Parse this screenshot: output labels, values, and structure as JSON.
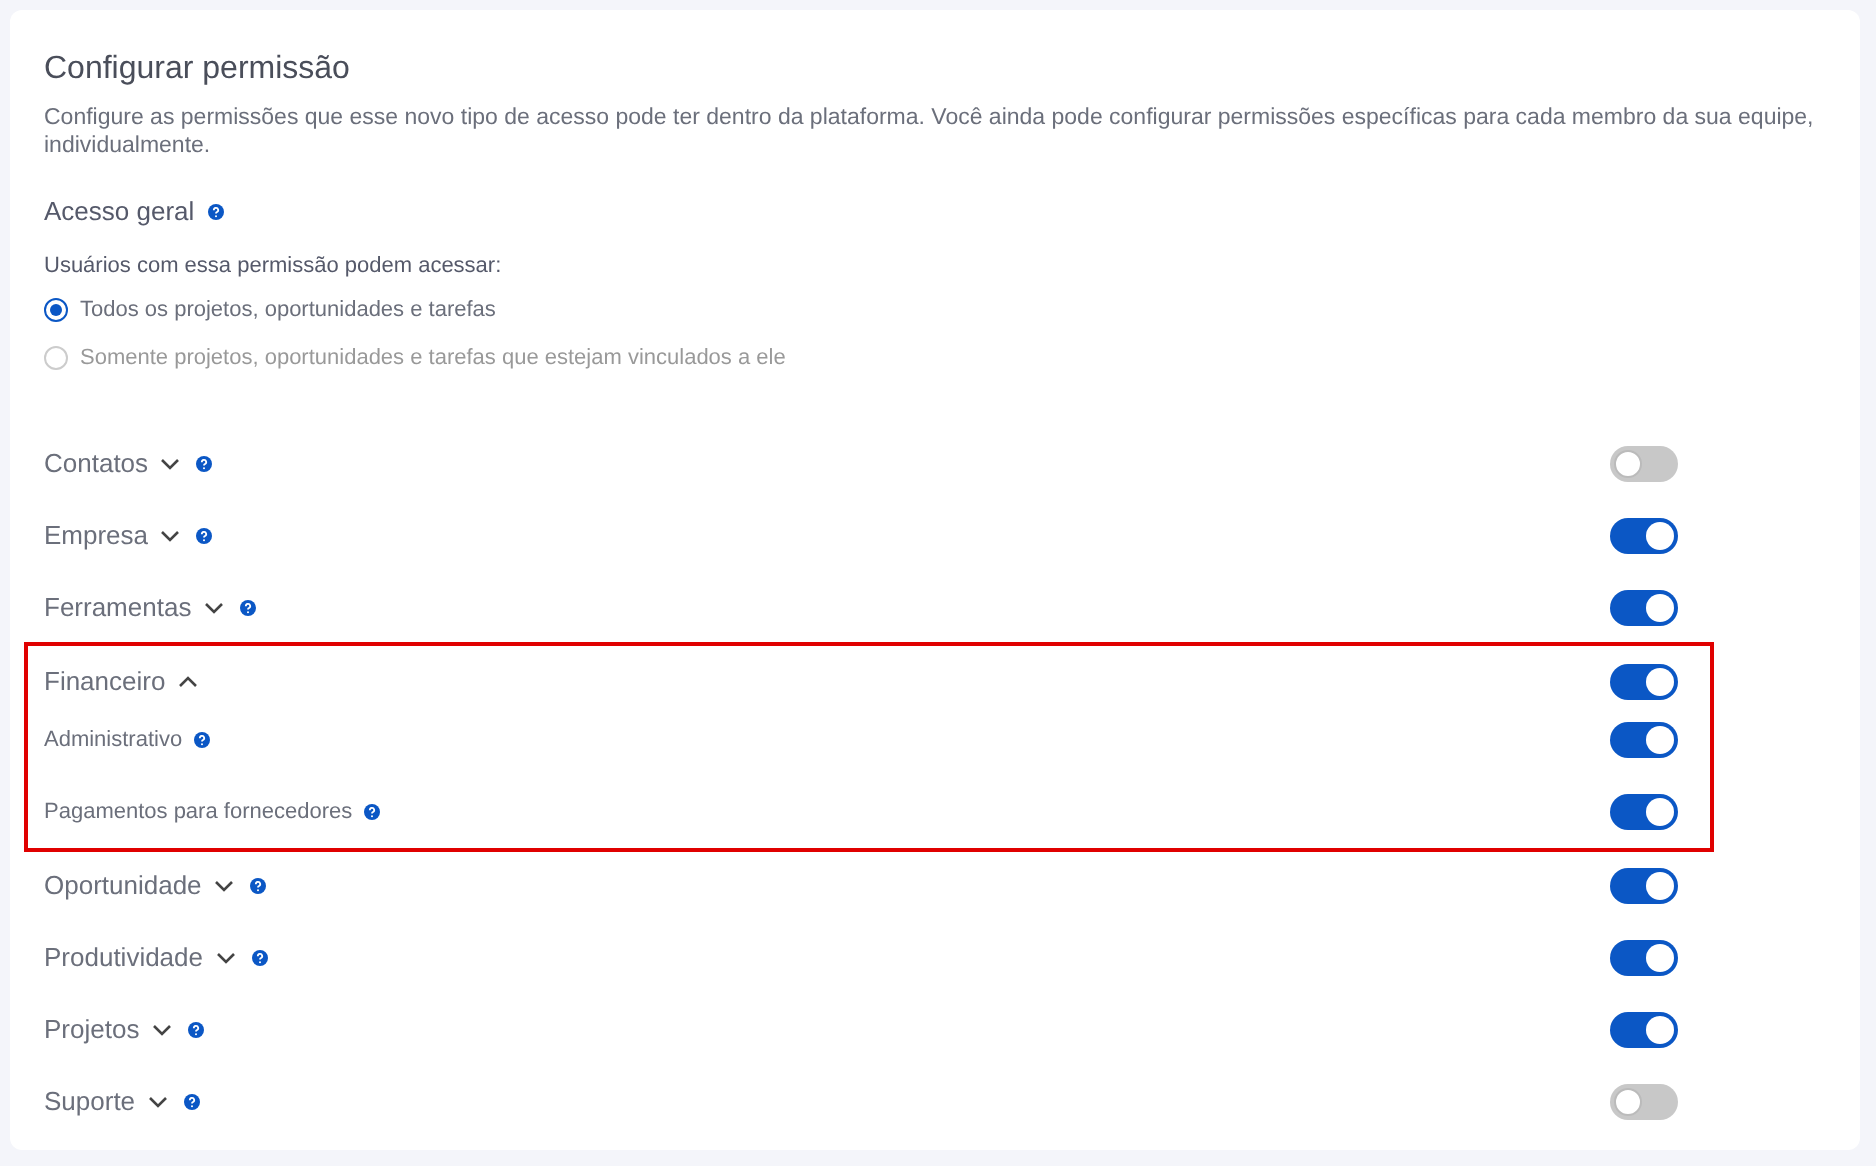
{
  "title": "Configurar permissão",
  "description": "Configure as permissões que esse novo tipo de acesso pode ter dentro da plataforma. Você ainda pode configurar permissões específicas para cada membro da sua equipe, individualmente.",
  "general_access": {
    "label": "Acesso geral",
    "help": true,
    "prompt": "Usuários com essa permissão podem acessar:",
    "options": [
      {
        "label": "Todos os projetos, oportunidades e tarefas",
        "selected": true
      },
      {
        "label": "Somente projetos, oportunidades e tarefas que estejam vinculados a ele",
        "selected": false
      }
    ]
  },
  "categories": [
    {
      "name": "Contatos",
      "expanded": false,
      "help": true,
      "on": false,
      "highlighted": false
    },
    {
      "name": "Empresa",
      "expanded": false,
      "help": true,
      "on": true,
      "highlighted": false
    },
    {
      "name": "Ferramentas",
      "expanded": false,
      "help": true,
      "on": true,
      "highlighted": false
    },
    {
      "name": "Financeiro",
      "expanded": true,
      "help": false,
      "on": true,
      "highlighted": true,
      "children": [
        {
          "name": "Administrativo",
          "help": true,
          "on": true
        },
        {
          "name": "Pagamentos para fornecedores",
          "help": true,
          "on": true
        }
      ]
    },
    {
      "name": "Oportunidade",
      "expanded": false,
      "help": true,
      "on": true,
      "highlighted": false
    },
    {
      "name": "Produtividade",
      "expanded": false,
      "help": true,
      "on": true,
      "highlighted": false
    },
    {
      "name": "Projetos",
      "expanded": false,
      "help": true,
      "on": true,
      "highlighted": false
    },
    {
      "name": "Suporte",
      "expanded": false,
      "help": true,
      "on": false,
      "highlighted": false
    }
  ]
}
